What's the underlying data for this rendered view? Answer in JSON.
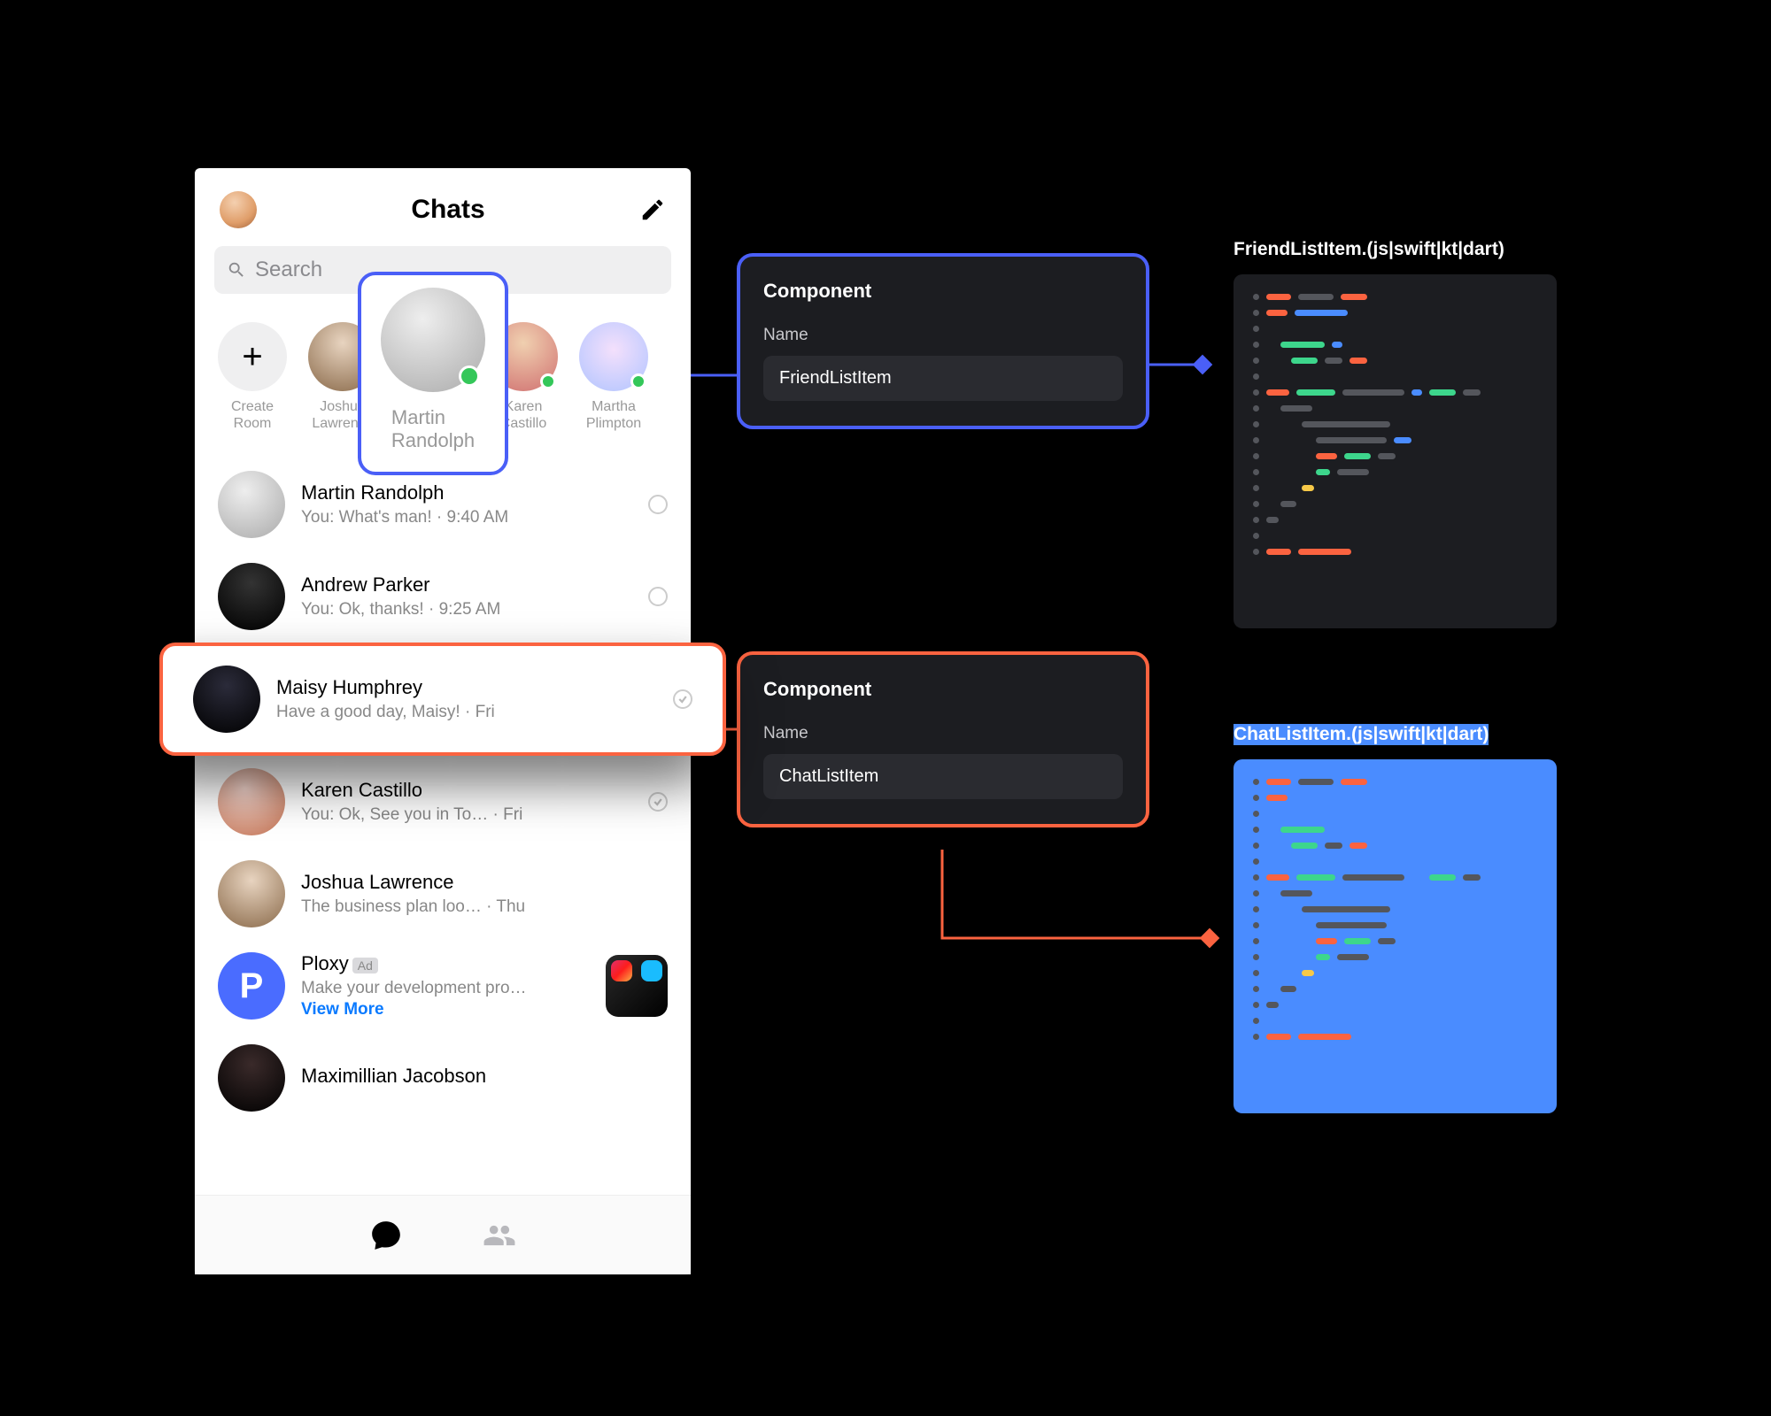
{
  "app": {
    "title": "Chats",
    "search_placeholder": "Search"
  },
  "stories": {
    "create": "Create\nRoom",
    "items": [
      {
        "name": "Joshua\nLawrence"
      },
      {
        "name": "Martin\nRandolph"
      },
      {
        "name": "Karen\nCastillo"
      },
      {
        "name": "Martha\nPlimpton"
      }
    ]
  },
  "friend_highlight": {
    "name": "Martin\nRandolph"
  },
  "chats": [
    {
      "name": "Martin Randolph",
      "preview": "You: What's man!  ·  9:40 AM",
      "status": "unread"
    },
    {
      "name": "Andrew Parker",
      "preview": "You: Ok, thanks!  ·  9:25 AM",
      "status": "unread"
    },
    {
      "name": "Maisy Humphrey",
      "preview": "Have a good day, Maisy!  ·  Fri",
      "status": "delivered",
      "highlighted": true
    },
    {
      "name": "Karen Castillo",
      "preview": "You: Ok, See you in To…  ·  Fri",
      "status": "delivered"
    },
    {
      "name": "Joshua Lawrence",
      "preview": "The business plan loo…  ·  Thu",
      "status": "none"
    },
    {
      "name": "Ploxy",
      "ad": true,
      "ad_badge": "Ad",
      "preview": "Make your development pro…",
      "viewmore": "View More"
    },
    {
      "name": "Maximillian Jacobson",
      "preview": "",
      "status": "none"
    }
  ],
  "panels": {
    "a": {
      "title": "Component",
      "label": "Name",
      "value": "FriendListItem"
    },
    "b": {
      "title": "Component",
      "label": "Name",
      "value": "ChatListItem"
    }
  },
  "files": {
    "a": "FriendListItem.(js|swift|kt|dart)",
    "b": "ChatListItem.(js|swift|kt|dart)"
  },
  "accent": {
    "blue": "#4a5ff7",
    "orange": "#fb6340"
  }
}
